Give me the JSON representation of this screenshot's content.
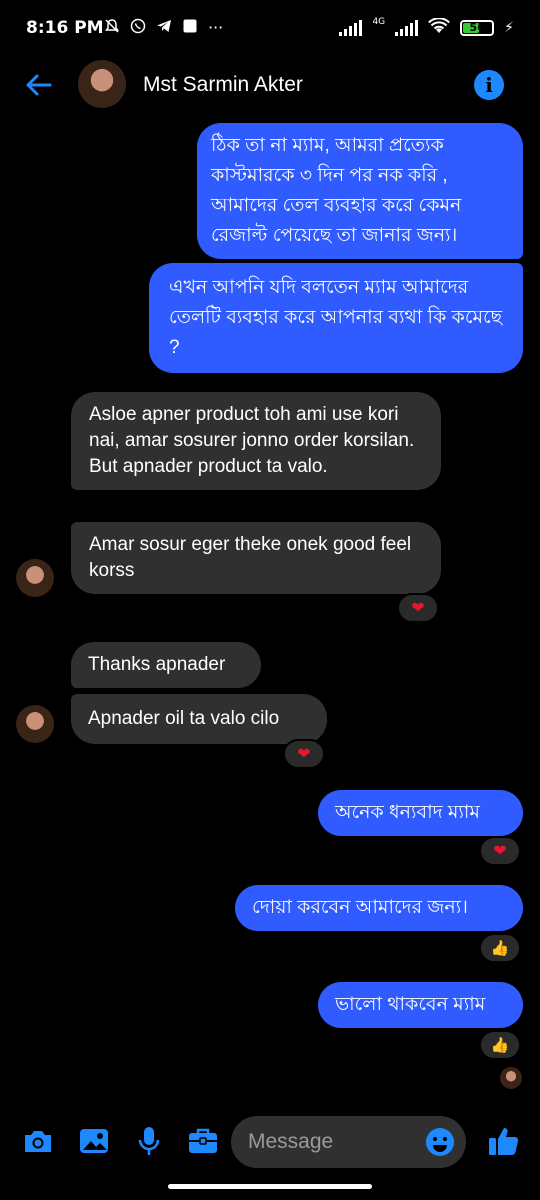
{
  "status_bar": {
    "time": "8:16 PM",
    "notif_icons": [
      "mute-icon",
      "whatsapp-icon",
      "telegram-icon",
      "square-icon"
    ],
    "more": "···",
    "network": "4G",
    "battery": "56",
    "battery_level": 0.56
  },
  "header": {
    "contact_name": "Mst Sarmin Akter",
    "info_glyph": "i"
  },
  "messages": [
    {
      "dir": "out",
      "text": "ঠিক তা না ম্যাম, আমরা প্রত্যেক কাস্টমারকে ৩ দিন পর নক করি , আমাদের তেল ব্যবহার করে কেমন রেজাল্ট পেয়েছে তা জানার জন্য।"
    },
    {
      "dir": "out",
      "text": "এখন আপনি যদি বলতেন ম্যাম আমাদের তেলটি ব্যবহার করে আপনার ব্যথা কি কমেছে ?"
    },
    {
      "dir": "in",
      "text": "Asloe apner product toh ami use kori nai, amar sosurer jonno order korsilan. But apnader product ta valo."
    },
    {
      "dir": "in",
      "text": "Amar sosur eger theke onek good feel korss",
      "reaction": "heart"
    },
    {
      "dir": "in",
      "text": "Thanks apnader"
    },
    {
      "dir": "in",
      "text": "Apnader oil ta valo cilo",
      "reaction": "heart"
    },
    {
      "dir": "out",
      "text": "অনেক ধন্যবাদ ম্যাম",
      "reaction": "heart"
    },
    {
      "dir": "out",
      "text": "দোয়া করবেন আমাদের জন্য।",
      "reaction": "thumbs-up"
    },
    {
      "dir": "out",
      "text": "ভালো থাকবেন ম্যাম",
      "reaction": "thumbs-up"
    }
  ],
  "reactions": {
    "heart": "❤",
    "thumbs_up": "👍"
  },
  "composer": {
    "placeholder": "Message",
    "icons": [
      "camera-icon",
      "gallery-icon",
      "microphone-icon",
      "briefcase-icon",
      "emoji-icon",
      "thumbs-up-icon"
    ]
  },
  "colors": {
    "outgoing_bubble": "#2f5bff",
    "incoming_bubble": "#303030",
    "accent": "#1e88ff",
    "heart": "#e8162f"
  }
}
